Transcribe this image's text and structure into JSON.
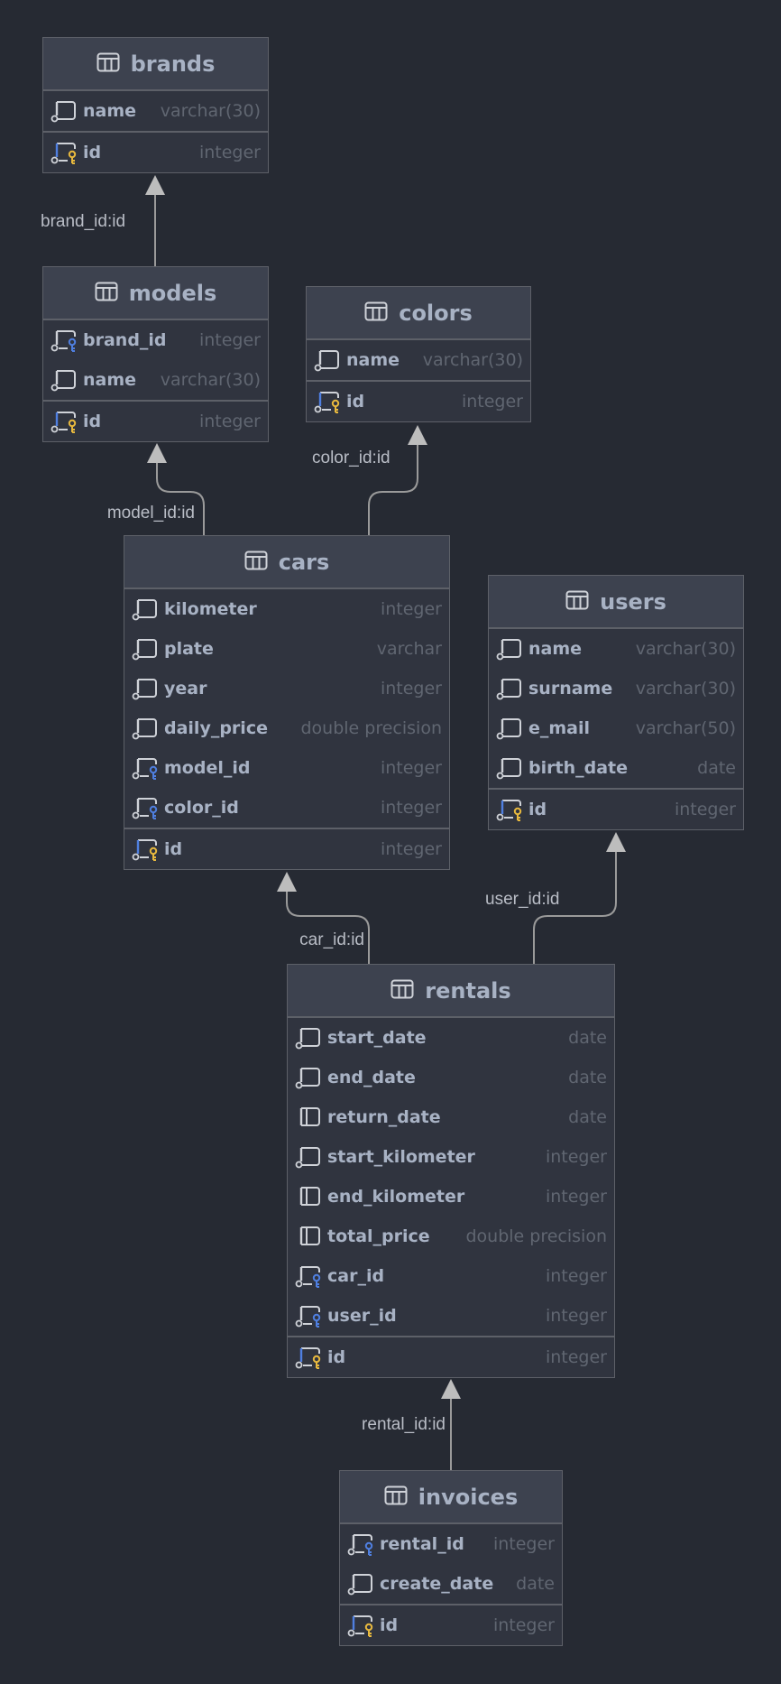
{
  "colors": {
    "background": "#262a33",
    "header": "#3d424f",
    "body": "#30343f",
    "border": "#5d6068",
    "pk_key": "#e8b93e",
    "fk_key": "#4f7fe0",
    "edge": "#9a9a9a"
  },
  "tables": [
    {
      "id": "brands",
      "name": "brands",
      "icon": "table-icon",
      "columns": [
        {
          "name": "name",
          "type": "varchar(30)",
          "not_null": true,
          "key": null
        },
        {
          "name": "id",
          "type": "integer",
          "not_null": true,
          "key": "pk"
        }
      ]
    },
    {
      "id": "models",
      "name": "models",
      "icon": "table-icon",
      "columns": [
        {
          "name": "brand_id",
          "type": "integer",
          "not_null": true,
          "key": "fk"
        },
        {
          "name": "name",
          "type": "varchar(30)",
          "not_null": true,
          "key": null
        },
        {
          "name": "id",
          "type": "integer",
          "not_null": true,
          "key": "pk"
        }
      ]
    },
    {
      "id": "colors",
      "name": "colors",
      "icon": "table-icon",
      "columns": [
        {
          "name": "name",
          "type": "varchar(30)",
          "not_null": true,
          "key": null
        },
        {
          "name": "id",
          "type": "integer",
          "not_null": true,
          "key": "pk"
        }
      ]
    },
    {
      "id": "cars",
      "name": "cars",
      "icon": "table-icon",
      "columns": [
        {
          "name": "kilometer",
          "type": "integer",
          "not_null": true,
          "key": null
        },
        {
          "name": "plate",
          "type": "varchar",
          "not_null": true,
          "key": null
        },
        {
          "name": "year",
          "type": "integer",
          "not_null": true,
          "key": null
        },
        {
          "name": "daily_price",
          "type": "double precision",
          "not_null": true,
          "key": null
        },
        {
          "name": "model_id",
          "type": "integer",
          "not_null": true,
          "key": "fk"
        },
        {
          "name": "color_id",
          "type": "integer",
          "not_null": true,
          "key": "fk"
        },
        {
          "name": "id",
          "type": "integer",
          "not_null": true,
          "key": "pk"
        }
      ]
    },
    {
      "id": "users",
      "name": "users",
      "icon": "table-icon",
      "columns": [
        {
          "name": "name",
          "type": "varchar(30)",
          "not_null": true,
          "key": null
        },
        {
          "name": "surname",
          "type": "varchar(30)",
          "not_null": true,
          "key": null
        },
        {
          "name": "e_mail",
          "type": "varchar(50)",
          "not_null": true,
          "key": null
        },
        {
          "name": "birth_date",
          "type": "date",
          "not_null": true,
          "key": null
        },
        {
          "name": "id",
          "type": "integer",
          "not_null": true,
          "key": "pk"
        }
      ]
    },
    {
      "id": "rentals",
      "name": "rentals",
      "icon": "table-icon",
      "columns": [
        {
          "name": "start_date",
          "type": "date",
          "not_null": true,
          "key": null
        },
        {
          "name": "end_date",
          "type": "date",
          "not_null": true,
          "key": null
        },
        {
          "name": "return_date",
          "type": "date",
          "not_null": false,
          "key": null
        },
        {
          "name": "start_kilometer",
          "type": "integer",
          "not_null": true,
          "key": null
        },
        {
          "name": "end_kilometer",
          "type": "integer",
          "not_null": false,
          "key": null
        },
        {
          "name": "total_price",
          "type": "double precision",
          "not_null": false,
          "key": null
        },
        {
          "name": "car_id",
          "type": "integer",
          "not_null": true,
          "key": "fk"
        },
        {
          "name": "user_id",
          "type": "integer",
          "not_null": true,
          "key": "fk"
        },
        {
          "name": "id",
          "type": "integer",
          "not_null": true,
          "key": "pk"
        }
      ]
    },
    {
      "id": "invoices",
      "name": "invoices",
      "icon": "table-icon",
      "columns": [
        {
          "name": "rental_id",
          "type": "integer",
          "not_null": true,
          "key": "fk"
        },
        {
          "name": "create_date",
          "type": "date",
          "not_null": true,
          "key": null
        },
        {
          "name": "id",
          "type": "integer",
          "not_null": true,
          "key": "pk"
        }
      ]
    }
  ],
  "relations": [
    {
      "from": "models",
      "to": "brands",
      "label": "brand_id:id"
    },
    {
      "from": "cars",
      "to": "models",
      "label": "model_id:id"
    },
    {
      "from": "cars",
      "to": "colors",
      "label": "color_id:id"
    },
    {
      "from": "rentals",
      "to": "cars",
      "label": "car_id:id"
    },
    {
      "from": "rentals",
      "to": "users",
      "label": "user_id:id"
    },
    {
      "from": "invoices",
      "to": "rentals",
      "label": "rental_id:id"
    }
  ]
}
